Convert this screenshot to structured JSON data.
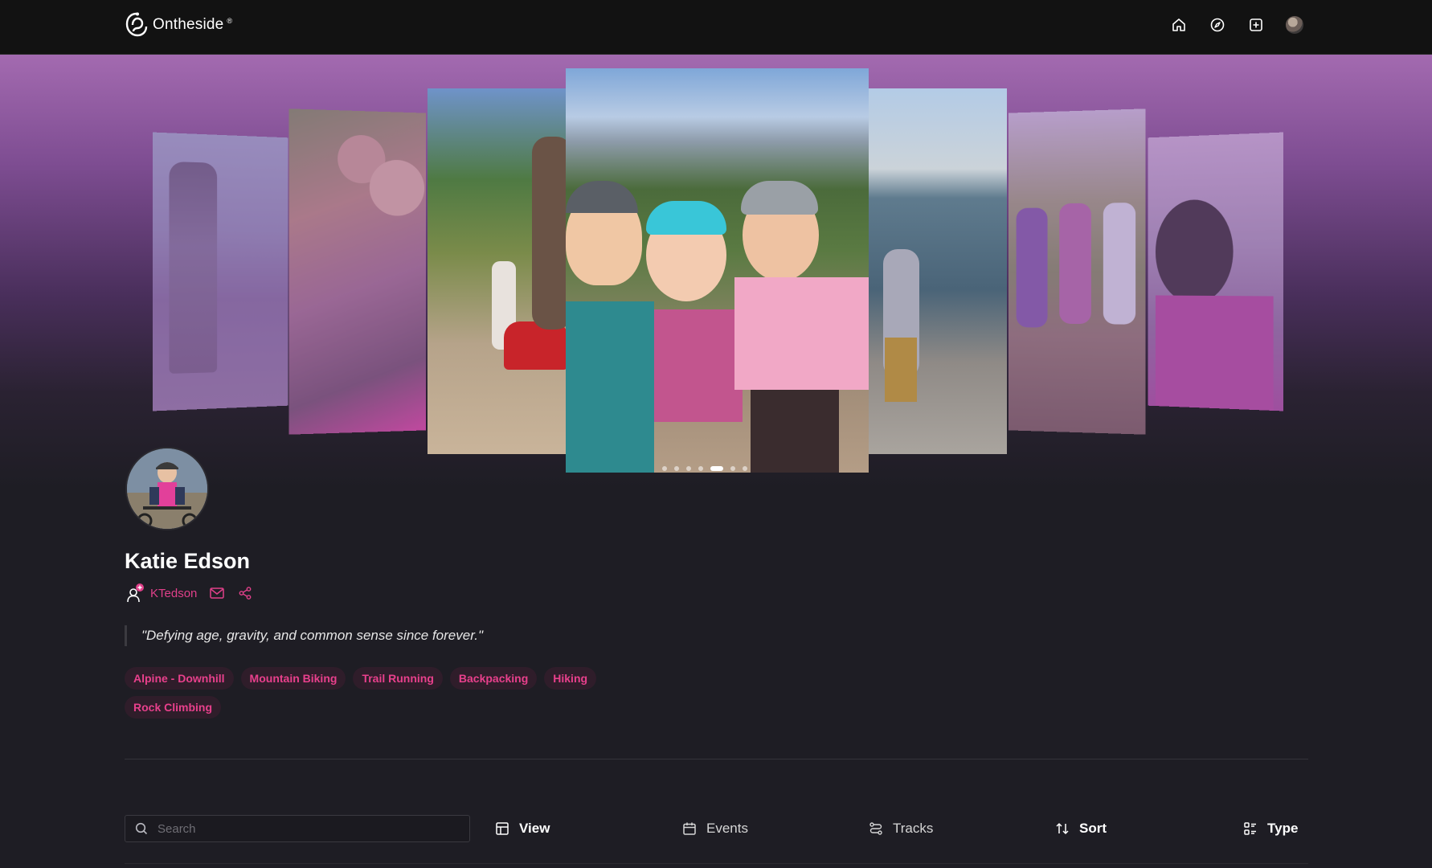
{
  "app": {
    "name": "Ontheside"
  },
  "nav": {
    "items": [
      {
        "name": "home",
        "icon": "home-icon"
      },
      {
        "name": "explore",
        "icon": "compass-icon"
      },
      {
        "name": "create",
        "icon": "plus-square-icon"
      },
      {
        "name": "profile",
        "icon": "avatar"
      }
    ]
  },
  "carousel": {
    "photo_count": 7,
    "dot_count": 7,
    "active_dot": 5
  },
  "profile": {
    "name": "Katie Edson",
    "handle": "KTedson",
    "bio": "\"Defying age, gravity, and common sense since forever.\"",
    "tags": [
      "Alpine - Downhill",
      "Mountain Biking",
      "Trail Running",
      "Backpacking",
      "Hiking",
      "Rock Climbing"
    ]
  },
  "toolbar": {
    "search_placeholder": "Search",
    "view_label": "View",
    "events_label": "Events",
    "tracks_label": "Tracks",
    "sort_label": "Sort",
    "type_label": "Type"
  },
  "colors": {
    "accent": "#e0408a",
    "background": "#1e1d24",
    "header": "#121212"
  }
}
